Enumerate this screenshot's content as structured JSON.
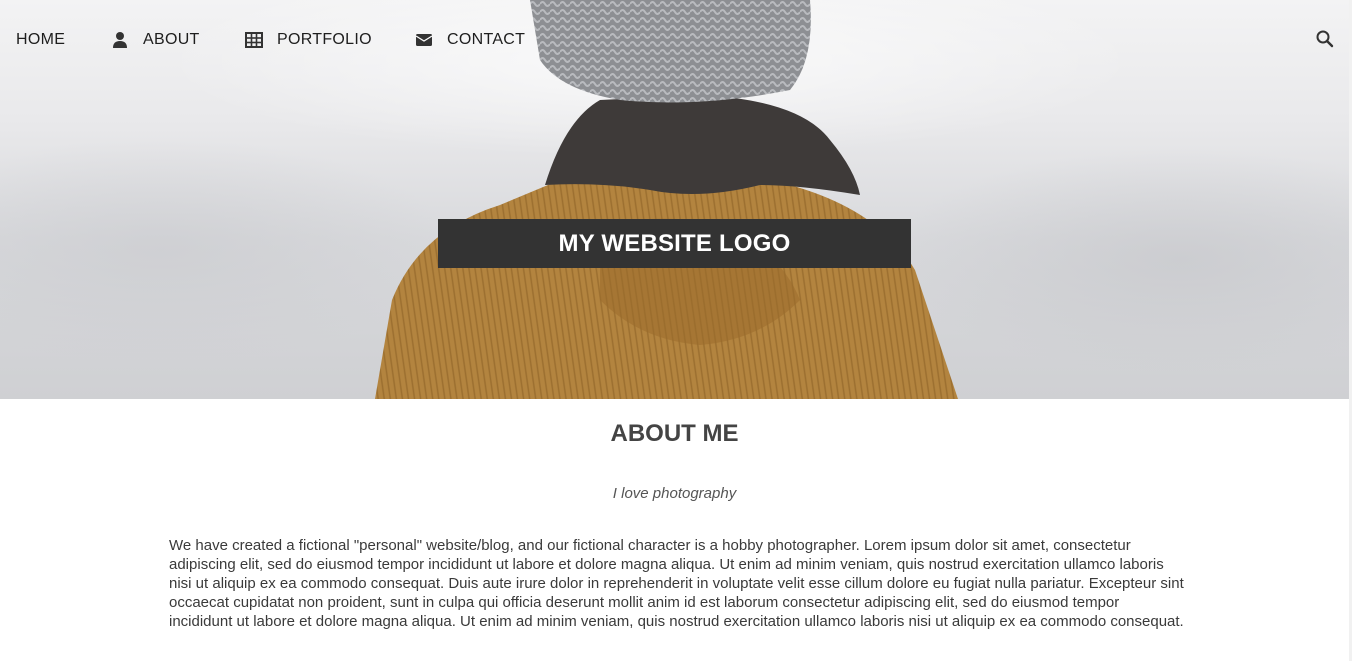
{
  "nav": {
    "items": [
      {
        "label": "HOME",
        "icon": ""
      },
      {
        "label": "ABOUT",
        "icon": "user-icon"
      },
      {
        "label": "PORTFOLIO",
        "icon": "grid-icon"
      },
      {
        "label": "CONTACT",
        "icon": "envelope-icon"
      }
    ],
    "search_icon": "search-icon"
  },
  "hero": {
    "logo_text": "MY WEBSITE LOGO"
  },
  "about": {
    "title": "ABOUT ME",
    "tagline": "I love photography",
    "body": "We have created a fictional \"personal\" website/blog, and our fictional character is a hobby photographer. Lorem ipsum dolor sit amet, consectetur adipiscing elit, sed do eiusmod tempor incididunt ut labore et dolore magna aliqua. Ut enim ad minim veniam, quis nostrud exercitation ullamco laboris nisi ut aliquip ex ea commodo consequat. Duis aute irure dolor in reprehenderit in voluptate velit esse cillum dolore eu fugiat nulla pariatur. Excepteur sint occaecat cupidatat non proident, sunt in culpa qui officia deserunt mollit anim id est laborum consectetur adipiscing elit, sed do eiusmod tempor incididunt ut labore et dolore magna aliqua. Ut enim ad minim veniam, quis nostrud exercitation ullamco laboris nisi ut aliquip ex ea commodo consequat."
  },
  "colors": {
    "logo_background": "#333333",
    "logo_text": "#ffffff",
    "nav_text": "#1e1e1e",
    "jacket": "#b0823f",
    "hat": "#8a8c90"
  }
}
